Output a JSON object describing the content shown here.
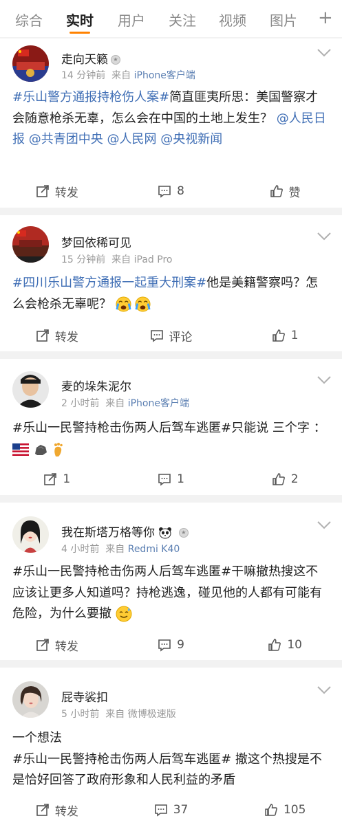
{
  "tabs": [
    {
      "label": "综合"
    },
    {
      "label": "实时",
      "active": true
    },
    {
      "label": "用户"
    },
    {
      "label": "关注"
    },
    {
      "label": "视频"
    },
    {
      "label": "图片"
    }
  ],
  "tabs_more": "+",
  "accent": "#ff8200",
  "link_color": "#3f6eb5",
  "posts": [
    {
      "user": "走向天籁",
      "time": "14 分钟前",
      "from_prefix": "来自",
      "source": "iPhone客户端",
      "body": {
        "tag1": "#乐山警方通报持枪伤人案#",
        "text1": "简直匪夷所思：美国警察才会随意枪杀无辜，怎么会在中国的土地上发生？",
        "mention1": "@人民日报",
        "mention2": "@共青团中央",
        "mention3": "@人民网",
        "mention4": "@央视新闻"
      },
      "repost": "转发",
      "comments": "8",
      "likes": "赞"
    },
    {
      "user": "梦回依稀可见",
      "time": "15 分钟前",
      "from_prefix": "来自",
      "source": "iPad Pro",
      "body": {
        "tag1": "#四川乐山警方通报一起重大刑案#",
        "text1": "他是美籍警察吗？怎么会枪杀无辜呢？"
      },
      "repost": "转发",
      "comments": "评论",
      "likes": "1"
    },
    {
      "user": "麦的垛朱泥尔",
      "time": "2 小时前",
      "from_prefix": "来自",
      "source": "iPhone客户端",
      "body": {
        "text1": "#乐山一民警持枪击伤两人后驾车逃匿#只能说 三个字 ："
      },
      "repost": "1",
      "comments": "1",
      "likes": "2"
    },
    {
      "user": "我在斯塔万格等你",
      "time": "4 小时前",
      "from_prefix": "来自",
      "source": "Redmi K40",
      "body": {
        "text1": "#乐山一民警持枪击伤两人后驾车逃匿#干嘛撤热搜这不应该让更多人知道吗？持枪逃逸，碰见他的人都有可能有危险，为什么要撤"
      },
      "repost": "转发",
      "comments": "9",
      "likes": "10"
    },
    {
      "user": "屁寺裟扣",
      "time": "5 小时前",
      "from_prefix": "来自",
      "source": "微博极速版",
      "body": {
        "line1": "一个想法",
        "text1": "#乐山一民警持枪击伤两人后驾车逃匿# 撤这个热搜是不是恰好回答了政府形象和人民利益的矛盾"
      },
      "repost": "转发",
      "comments": "37",
      "likes": "105"
    }
  ]
}
